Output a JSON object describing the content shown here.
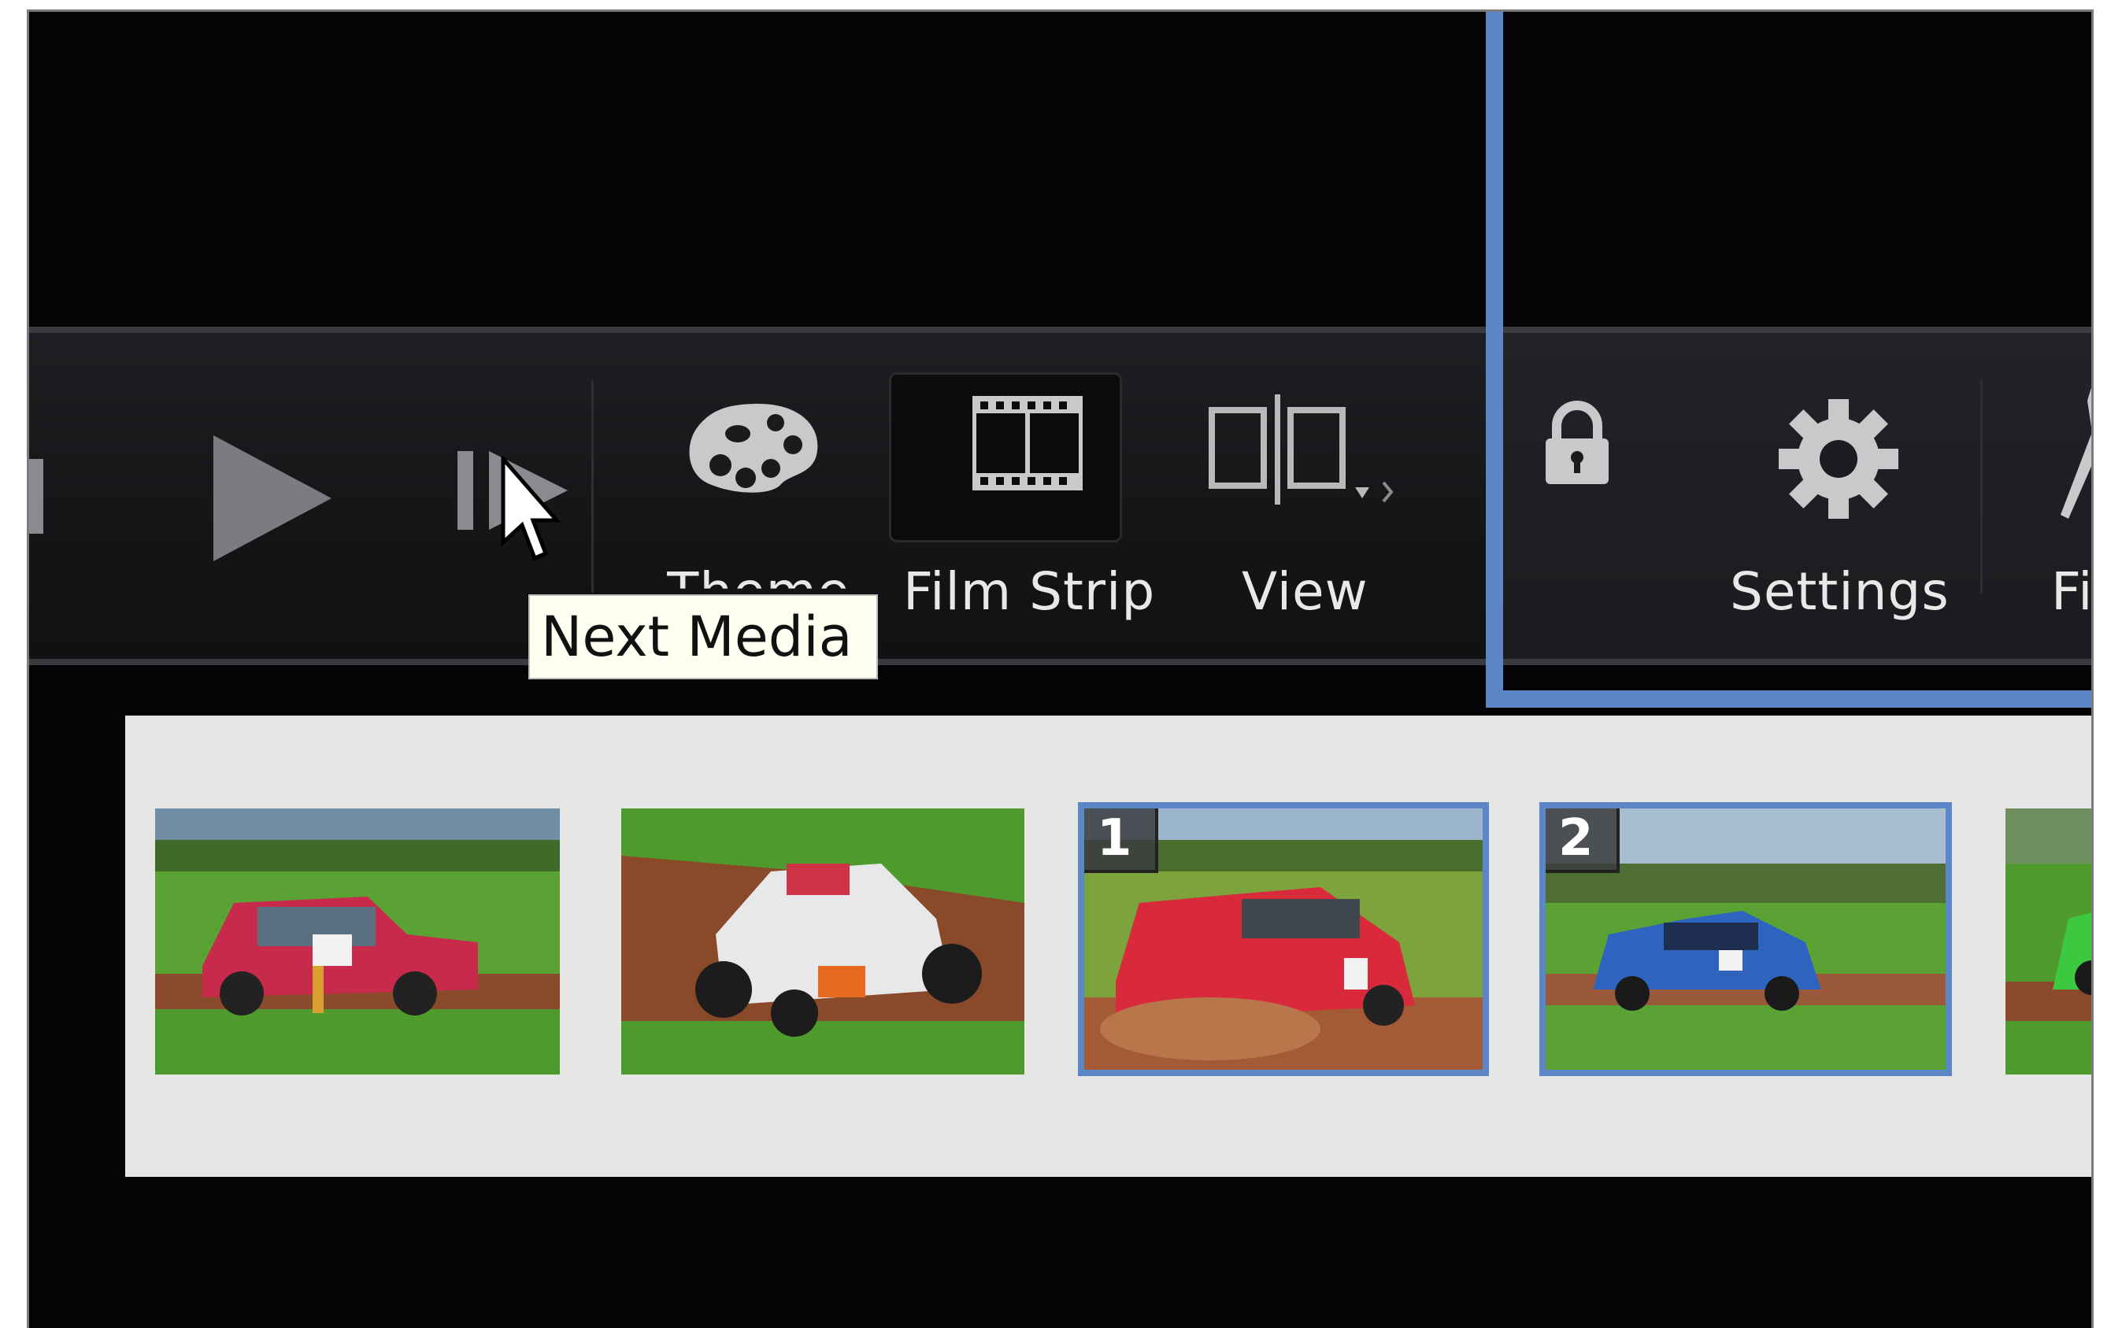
{
  "toolbar": {
    "buttons": [
      {
        "id": "previous",
        "label": "",
        "icon": "previous-icon"
      },
      {
        "id": "play",
        "label": "",
        "icon": "play-icon"
      },
      {
        "id": "next",
        "label": "",
        "icon": "next-media-icon"
      },
      {
        "id": "theme",
        "label": "Theme",
        "icon": "palette-icon"
      },
      {
        "id": "film-strip",
        "label": "Film Strip",
        "icon": "film-strip-icon"
      },
      {
        "id": "view",
        "label": "View",
        "icon": "view-split-icon"
      },
      {
        "id": "lock",
        "label": "",
        "icon": "lock-icon"
      },
      {
        "id": "settings",
        "label": "Settings",
        "icon": "gear-icon"
      },
      {
        "id": "fi",
        "label": "Fi",
        "icon": "tool-icon"
      }
    ]
  },
  "tooltip": {
    "text": "Next Media"
  },
  "filmstrip": {
    "thumbnails": [
      {
        "badge": "",
        "selected": false,
        "subject": "red mini rally car"
      },
      {
        "badge": "",
        "selected": false,
        "subject": "white buggy on dirt"
      },
      {
        "badge": "1",
        "selected": true,
        "subject": "red mini kicking up dirt"
      },
      {
        "badge": "2",
        "selected": true,
        "subject": "blue hatchback rally car"
      },
      {
        "badge": "",
        "selected": false,
        "subject": "green car partial"
      }
    ]
  },
  "colors": {
    "selection": "#5b86c8",
    "toolbar_bg": "#141517",
    "panel_bg": "#e6e6e4",
    "tooltip_bg": "#fffff2"
  }
}
